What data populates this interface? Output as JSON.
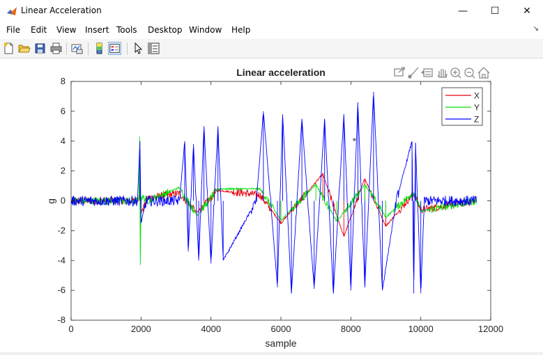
{
  "window": {
    "title": "Linear Acceleration",
    "minimize": "—",
    "maximize": "☐",
    "close": "✕"
  },
  "menu": [
    "File",
    "Edit",
    "View",
    "Insert",
    "Tools",
    "Desktop",
    "Window",
    "Help"
  ],
  "toolbar_icons": [
    "new-figure-icon",
    "open-file-icon",
    "save-icon",
    "print-icon",
    "link-plot-icon",
    "insert-colorbar-icon",
    "insert-legend-icon",
    "edit-plot-icon",
    "property-inspector-icon"
  ],
  "axes_toolbar_icons": [
    "export-icon",
    "brush-icon",
    "data-tips-icon",
    "pan-icon",
    "zoom-in-icon",
    "zoom-out-icon",
    "home-icon"
  ],
  "chart_data": {
    "type": "line",
    "title": "Linear acceleration",
    "xlabel": "sample",
    "ylabel": "g",
    "xlim": [
      0,
      12000
    ],
    "ylim": [
      -8,
      8
    ],
    "xticks": [
      0,
      2000,
      4000,
      6000,
      8000,
      10000,
      12000
    ],
    "yticks": [
      -8,
      -6,
      -4,
      -2,
      0,
      2,
      4,
      6,
      8
    ],
    "grid": false,
    "legend_position": "top-right",
    "series_colors": {
      "X": "#e8000b",
      "Y": "#00e000",
      "Z": "#0000ff"
    },
    "series": [
      {
        "name": "X",
        "x": [
          0,
          1900,
          1960,
          2000,
          2200,
          3100,
          3600,
          4200,
          5400,
          6000,
          7200,
          7800,
          8400,
          9000,
          9800,
          10000,
          11600
        ],
        "values": [
          0,
          0,
          0.6,
          -0.8,
          0.2,
          0.5,
          -0.8,
          0.7,
          0.4,
          -1.5,
          1.8,
          -2.4,
          1.5,
          -1.7,
          0.5,
          -0.6,
          0
        ]
      },
      {
        "name": "Y",
        "x": [
          0,
          1940,
          1960,
          1980,
          2000,
          2200,
          3100,
          3600,
          4200,
          5400,
          6000,
          7000,
          7600,
          8400,
          9000,
          9800,
          10000,
          11600
        ],
        "values": [
          0,
          0,
          4.3,
          -4.3,
          0.3,
          0,
          0.9,
          -1.0,
          0.8,
          0.8,
          -1.3,
          1.1,
          -1.4,
          1.1,
          -1.1,
          0.6,
          -0.7,
          0
        ]
      },
      {
        "name": "Z",
        "x": [
          0,
          1900,
          1970,
          2000,
          2150,
          3100,
          3250,
          3350,
          3500,
          3650,
          3800,
          4000,
          4200,
          4350,
          5300,
          5500,
          5900,
          6050,
          6300,
          6600,
          6950,
          7250,
          7500,
          7800,
          8000,
          8200,
          8400,
          8650,
          8900,
          9300,
          9750,
          9800,
          9850,
          10000,
          10100,
          11600
        ],
        "values": [
          0,
          0,
          4.0,
          -1.5,
          0,
          0,
          4.0,
          -3.4,
          3.8,
          -4.0,
          5.0,
          -4.2,
          5.0,
          -4.0,
          0,
          6.0,
          -5.8,
          5.8,
          -6.2,
          5.5,
          -5.9,
          5.5,
          -6.2,
          5.8,
          -6.0,
          6.6,
          -5.8,
          7.3,
          -6.0,
          0,
          4.0,
          -6.2,
          3.9,
          -6.2,
          0,
          0
        ]
      }
    ]
  }
}
